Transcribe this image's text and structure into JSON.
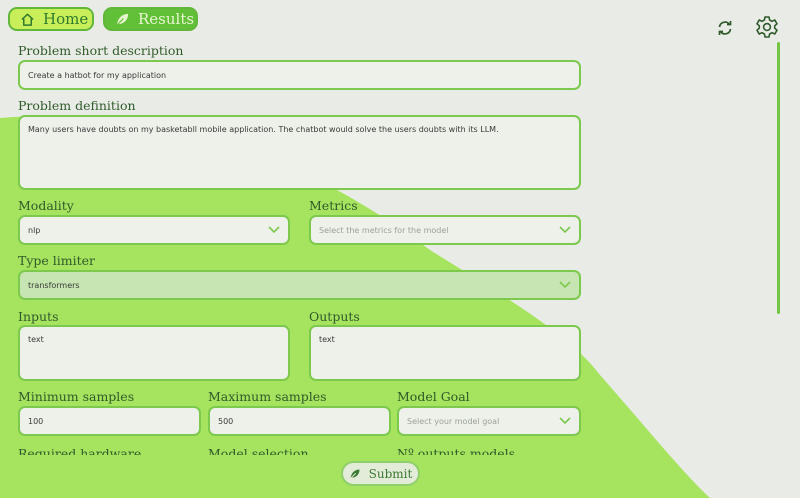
{
  "nav": {
    "home_label": "Home",
    "results_label": "Results"
  },
  "icons": {
    "home": "home-icon",
    "results": "leaf-icon",
    "refresh": "refresh-icon",
    "settings": "gear-icon",
    "submit": "leaf-icon",
    "dropdown": "chevron-down-icon"
  },
  "colors": {
    "accent": "#62bf38",
    "blob": "#a6e35e",
    "home_button": "#c8ef5a",
    "field_border": "#7cc94d",
    "background": "#e9ece6"
  },
  "form": {
    "short_description": {
      "label": "Problem short description",
      "value": "Create a hatbot for my application"
    },
    "definition": {
      "label": "Problem definition",
      "value": "Many users have doubts on my basketabll mobile application. The chatbot would solve the users doubts with its LLM."
    },
    "modality": {
      "label": "Modality",
      "value": "nlp"
    },
    "metrics": {
      "label": "Metrics",
      "placeholder": "Select the metrics for the model"
    },
    "type_limiter": {
      "label": "Type limiter",
      "value": "transformers"
    },
    "inputs": {
      "label": "Inputs",
      "value": "text"
    },
    "outputs": {
      "label": "Outputs",
      "value": "text"
    },
    "min_samples": {
      "label": "Minimum samples",
      "value": "100"
    },
    "max_samples": {
      "label": "Maximum samples",
      "value": "500"
    },
    "model_goal": {
      "label": "Model Goal",
      "placeholder": "Select your model goal"
    },
    "required_hardware": {
      "label": "Required hardware"
    },
    "model_selection": {
      "label": "Model selection"
    },
    "num_outputs_models": {
      "label": "Nº outputs models"
    }
  },
  "submit": {
    "label": "Submit"
  }
}
